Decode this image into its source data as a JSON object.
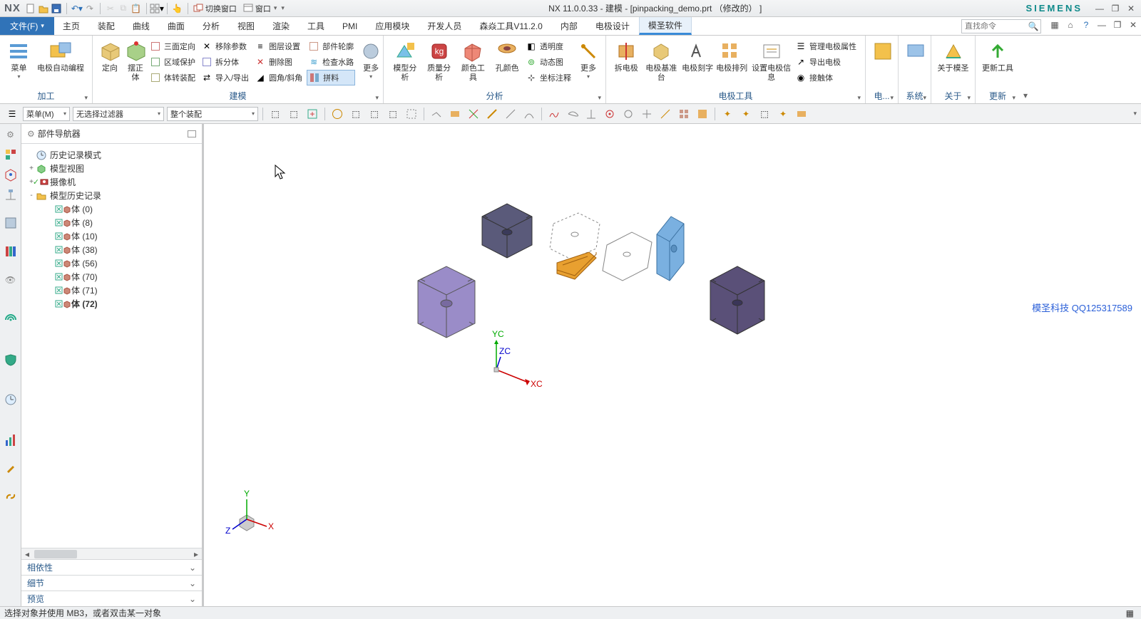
{
  "app": {
    "logo": "NX",
    "title": "NX 11.0.0.33 - 建模 - [pinpacking_demo.prt （修改的） ]",
    "brand": "SIEMENS",
    "qa_switch": "切换窗口",
    "qa_window": "窗口"
  },
  "menu": {
    "file": "文件(F)",
    "tabs": [
      "主页",
      "装配",
      "曲线",
      "曲面",
      "分析",
      "视图",
      "渲染",
      "工具",
      "PMI",
      "应用模块",
      "开发人员",
      "森焱工具V11.2.0",
      "内部",
      "电极设计",
      "模圣软件"
    ],
    "active": 14,
    "search_placeholder": "直找命令"
  },
  "ribbon": {
    "groups": {
      "g1": {
        "label": "加工",
        "menu": "菜单",
        "btn": "电极自动编程"
      },
      "g2": {
        "label": "建模",
        "big": [
          "定向",
          "摆正体"
        ],
        "col1": [
          "三面定向",
          "区域保护",
          "体转装配"
        ],
        "col2": [
          "移除参数",
          "拆分体",
          "导入/导出"
        ],
        "col3": [
          "图层设置",
          "删除图",
          "圆角/斜角"
        ],
        "col4": [
          "部件轮廓",
          "检查水路",
          "拼料"
        ],
        "more": "更多"
      },
      "g3": {
        "label": "分析",
        "big": [
          "模型分析",
          "质量分析",
          "颜色工具",
          "孔颜色"
        ],
        "col": [
          "透明度",
          "动态图",
          "坐标注释"
        ],
        "more": "更多"
      },
      "g4": {
        "label": "电极工具",
        "big": [
          "拆电极",
          "电极基准台",
          "电极刻字",
          "电极排列",
          "设置电极信息"
        ],
        "col": [
          "管理电极属性",
          "导出电极",
          "接触体"
        ]
      },
      "g5": {
        "labels": [
          "电...",
          "系统",
          "关于",
          "更新"
        ],
        "big": [
          "",
          "",
          "关于模圣",
          "更新工具"
        ]
      }
    }
  },
  "selbar": {
    "menu": "菜单(M)",
    "filter": "无选择过滤器",
    "assembly": "整个装配"
  },
  "nav": {
    "title": "部件导航器",
    "tree": [
      {
        "lbl": "历史记录模式",
        "exp": "",
        "depth": 0,
        "ic": "clock"
      },
      {
        "lbl": "模型视图",
        "exp": "+",
        "depth": 0,
        "ic": "cube-green"
      },
      {
        "lbl": "摄像机",
        "exp": "+",
        "depth": 0,
        "ic": "camera"
      },
      {
        "lbl": "模型历史记录",
        "exp": "-",
        "depth": 0,
        "ic": "folder"
      },
      {
        "lbl": "体 (0)",
        "exp": "",
        "depth": 1,
        "ic": "body"
      },
      {
        "lbl": "体 (8)",
        "exp": "",
        "depth": 1,
        "ic": "body"
      },
      {
        "lbl": "体 (10)",
        "exp": "",
        "depth": 1,
        "ic": "body"
      },
      {
        "lbl": "体 (38)",
        "exp": "",
        "depth": 1,
        "ic": "body"
      },
      {
        "lbl": "体 (56)",
        "exp": "",
        "depth": 1,
        "ic": "body"
      },
      {
        "lbl": "体 (70)",
        "exp": "",
        "depth": 1,
        "ic": "body"
      },
      {
        "lbl": "体 (71)",
        "exp": "",
        "depth": 1,
        "ic": "body"
      },
      {
        "lbl": "体 (72)",
        "exp": "",
        "depth": 1,
        "ic": "body",
        "bold": true
      }
    ],
    "foot": [
      "相依性",
      "细节",
      "预览"
    ]
  },
  "viewport": {
    "watermark": "模圣科技  QQ125317589",
    "axes": {
      "x": "XC",
      "y": "YC",
      "z": "ZC"
    },
    "triad": {
      "x": "X",
      "y": "Y",
      "z": "Z"
    }
  },
  "status": "选择对象并使用 MB3，或者双击某一对象"
}
